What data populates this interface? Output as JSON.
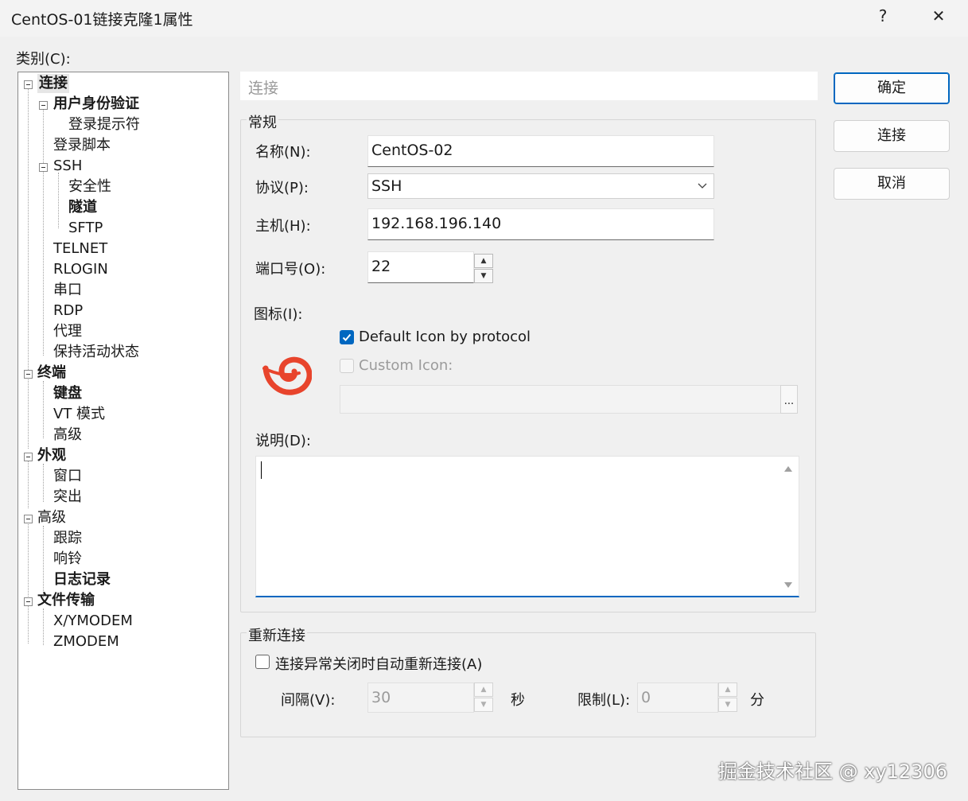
{
  "window": {
    "title": "CentOS-01链接克隆1属性",
    "help": "?",
    "close": "✕"
  },
  "category_label": "类别(C):",
  "tree": [
    {
      "label": "连接",
      "bold": true,
      "selected": true
    },
    {
      "label": "用户身份验证",
      "bold": true
    },
    {
      "label": "登录提示符",
      "bold": false
    },
    {
      "label": "登录脚本",
      "bold": false
    },
    {
      "label": "SSH",
      "bold": false
    },
    {
      "label": "安全性",
      "bold": false
    },
    {
      "label": "隧道",
      "bold": true
    },
    {
      "label": "SFTP",
      "bold": false
    },
    {
      "label": "TELNET",
      "bold": false
    },
    {
      "label": "RLOGIN",
      "bold": false
    },
    {
      "label": "串口",
      "bold": false
    },
    {
      "label": "RDP",
      "bold": false
    },
    {
      "label": "代理",
      "bold": false
    },
    {
      "label": "保持活动状态",
      "bold": false
    },
    {
      "label": "终端",
      "bold": true
    },
    {
      "label": "键盘",
      "bold": true
    },
    {
      "label": "VT 模式",
      "bold": false
    },
    {
      "label": "高级",
      "bold": false
    },
    {
      "label": "外观",
      "bold": true
    },
    {
      "label": "窗口",
      "bold": false
    },
    {
      "label": "突出",
      "bold": false
    },
    {
      "label": "高级",
      "bold": false
    },
    {
      "label": "跟踪",
      "bold": false
    },
    {
      "label": "响铃",
      "bold": false
    },
    {
      "label": "日志记录",
      "bold": true
    },
    {
      "label": "文件传输",
      "bold": true
    },
    {
      "label": "X/YMODEM",
      "bold": false
    },
    {
      "label": "ZMODEM",
      "bold": false
    }
  ],
  "panel": {
    "header": "连接"
  },
  "general": {
    "legend": "常规",
    "name_label": "名称(N):",
    "name_value": "CentOS-02",
    "protocol_label": "协议(P):",
    "protocol_value": "SSH",
    "host_label": "主机(H):",
    "host_value": "192.168.196.140",
    "port_label": "端口号(O):",
    "port_value": "22",
    "icon_label": "图标(I):",
    "default_icon": "Default Icon by protocol",
    "custom_icon": "Custom Icon:",
    "browse": "...",
    "desc_label": "说明(D):",
    "desc_value": ""
  },
  "reconnect": {
    "legend": "重新连接",
    "auto_label": "连接异常关闭时自动重新连接(A)",
    "interval_label": "间隔(V):",
    "interval_value": "30",
    "interval_unit": "秒",
    "limit_label": "限制(L):",
    "limit_value": "0",
    "limit_unit": "分"
  },
  "buttons": {
    "ok": "确定",
    "connect": "连接",
    "cancel": "取消"
  },
  "watermark": "掘金技术社区 @ xy12306",
  "colors": {
    "accent": "#0067c0",
    "icon_red": "#e8442c"
  }
}
